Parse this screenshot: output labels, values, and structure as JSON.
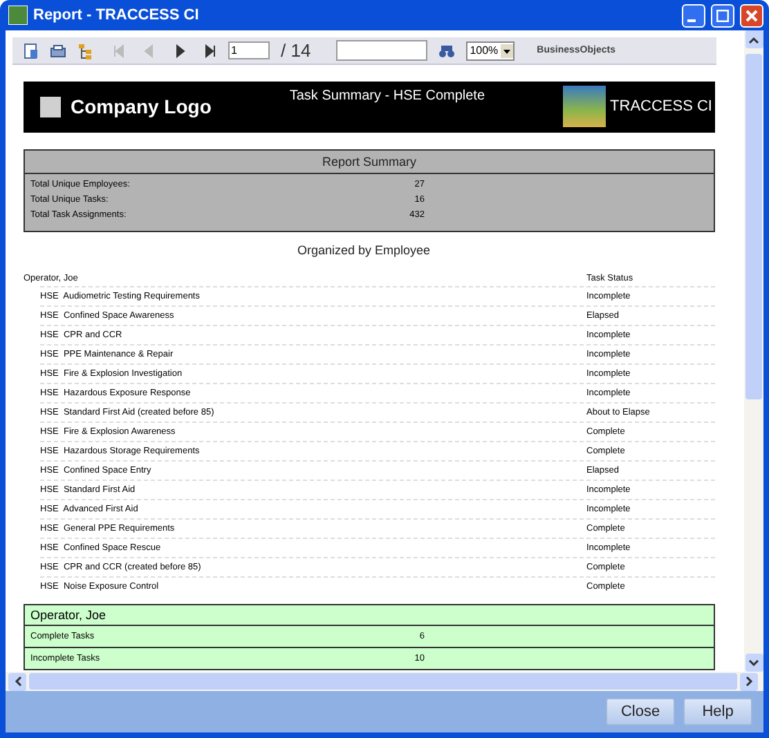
{
  "window": {
    "title": "Report - TRACCESS CI"
  },
  "toolbar": {
    "nav": [
      {
        "kind": "first",
        "disabled": true
      },
      {
        "kind": "prev",
        "disabled": true
      },
      {
        "kind": "next",
        "disabled": false
      },
      {
        "kind": "last",
        "disabled": false
      }
    ],
    "page": "1",
    "page_total": "/ 14",
    "zoom": "100%",
    "brand": "BusinessObjects"
  },
  "report_header": {
    "logo_text": "Company Logo",
    "title": "Task Summary - HSE Complete",
    "brand": "TRACCESS CI"
  },
  "summary": {
    "title": "Report Summary",
    "rows": [
      {
        "label": "Total Unique Employees:",
        "value": "27"
      },
      {
        "label": "Total Unique Tasks:",
        "value": "16"
      },
      {
        "label": "Total Task Assignments:",
        "value": "432"
      }
    ]
  },
  "section_title": "Organized by Employee",
  "group": {
    "employee": "Operator, Joe",
    "status_heading": "Task Status",
    "tasks": [
      {
        "prefix": "HSE",
        "name": "Audiometric Testing Requirements",
        "status": "Incomplete"
      },
      {
        "prefix": "HSE",
        "name": "Confined Space Awareness",
        "status": "Elapsed"
      },
      {
        "prefix": "HSE",
        "name": "CPR and CCR",
        "status": "Incomplete"
      },
      {
        "prefix": "HSE",
        "name": "PPE Maintenance & Repair",
        "status": "Incomplete"
      },
      {
        "prefix": "HSE",
        "name": "Fire & Explosion Investigation",
        "status": "Incomplete"
      },
      {
        "prefix": "HSE",
        "name": "Hazardous Exposure Response",
        "status": "Incomplete"
      },
      {
        "prefix": "HSE",
        "name": "Standard First Aid (created before 85)",
        "status": "About to Elapse"
      },
      {
        "prefix": "HSE",
        "name": "Fire & Explosion Awareness",
        "status": "Complete"
      },
      {
        "prefix": "HSE",
        "name": "Hazardous Storage Requirements",
        "status": "Complete"
      },
      {
        "prefix": "HSE",
        "name": "Confined Space Entry",
        "status": "Elapsed"
      },
      {
        "prefix": "HSE",
        "name": "Standard First Aid",
        "status": "Incomplete"
      },
      {
        "prefix": "HSE",
        "name": "Advanced First Aid",
        "status": "Incomplete"
      },
      {
        "prefix": "HSE",
        "name": "General PPE Requirements",
        "status": "Complete"
      },
      {
        "prefix": "HSE",
        "name": "Confined Space Rescue",
        "status": "Incomplete"
      },
      {
        "prefix": "HSE",
        "name": "CPR and CCR (created before 85)",
        "status": "Complete"
      },
      {
        "prefix": "HSE",
        "name": "Noise Exposure Control",
        "status": "Complete"
      }
    ]
  },
  "totals": {
    "title": "Operator, Joe",
    "rows": [
      {
        "label": "Complete Tasks",
        "value": "6"
      },
      {
        "label": "Incomplete Tasks",
        "value": "10"
      }
    ]
  },
  "buttons": [
    "Close",
    "Help"
  ]
}
